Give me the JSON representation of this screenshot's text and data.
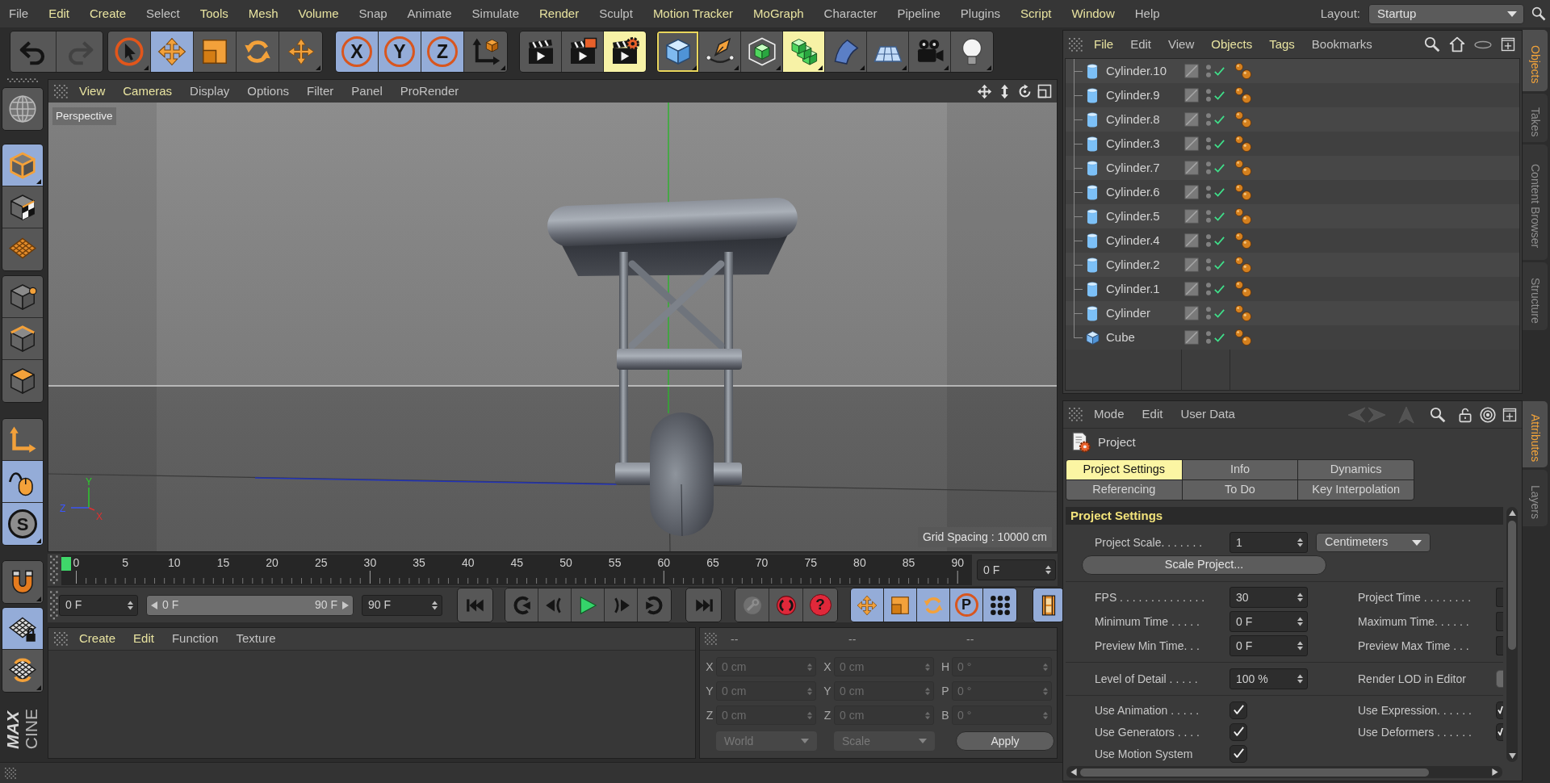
{
  "menu_bar": {
    "items": [
      {
        "label": "File",
        "highlighted": false
      },
      {
        "label": "Edit",
        "highlighted": true
      },
      {
        "label": "Create",
        "highlighted": true
      },
      {
        "label": "Select",
        "highlighted": false
      },
      {
        "label": "Tools",
        "highlighted": true
      },
      {
        "label": "Mesh",
        "highlighted": true
      },
      {
        "label": "Volume",
        "highlighted": true
      },
      {
        "label": "Snap",
        "highlighted": false
      },
      {
        "label": "Animate",
        "highlighted": false
      },
      {
        "label": "Simulate",
        "highlighted": false
      },
      {
        "label": "Render",
        "highlighted": true
      },
      {
        "label": "Sculpt",
        "highlighted": false
      },
      {
        "label": "Motion Tracker",
        "highlighted": true
      },
      {
        "label": "MoGraph",
        "highlighted": true
      },
      {
        "label": "Character",
        "highlighted": false
      },
      {
        "label": "Pipeline",
        "highlighted": false
      },
      {
        "label": "Plugins",
        "highlighted": false
      },
      {
        "label": "Script",
        "highlighted": true
      },
      {
        "label": "Window",
        "highlighted": true
      },
      {
        "label": "Help",
        "highlighted": false
      }
    ],
    "layout_label": "Layout:",
    "layout_value": "Startup"
  },
  "toolbar": {
    "groups": [
      {
        "tools": [
          {
            "disabled": false
          },
          {
            "disabled": true
          }
        ]
      },
      {
        "tools": [
          {
            "selected": false
          },
          {
            "selected": true
          },
          {
            "selected": false
          },
          {
            "selected": false
          },
          {
            "selected": false
          }
        ]
      },
      {
        "tools": [
          {
            "label": "X",
            "selected": true
          },
          {
            "label": "Y",
            "selected": true
          },
          {
            "label": "Z",
            "selected": true
          },
          {
            "selected": false
          }
        ]
      },
      {
        "tools": [
          {
            "highlighted": false
          },
          {
            "highlighted": false
          },
          {
            "highlighted": true
          }
        ]
      },
      {
        "tools": [
          {
            "highlighted": false,
            "focused": true
          },
          {
            "highlighted": false,
            "focused": false
          },
          {
            "highlighted": false,
            "focused": false
          },
          {
            "highlighted": true,
            "focused": false
          },
          {
            "highlighted": false,
            "focused": false
          },
          {
            "highlighted": false,
            "focused": false
          },
          {
            "highlighted": false,
            "focused": false
          },
          {
            "highlighted": false,
            "focused": false
          }
        ]
      }
    ]
  },
  "left_toolbar": {
    "tools": [
      {
        "selected": false
      },
      {
        "selected": true
      },
      {
        "selected": false
      },
      {
        "selected": false
      },
      {
        "selected": false
      },
      {
        "selected": false
      },
      {
        "selected": false
      },
      {
        "selected": false
      },
      {
        "selected": true
      },
      {
        "label": "S",
        "selected": true
      },
      {
        "selected": false
      },
      {
        "selected": true
      },
      {
        "selected": false
      }
    ],
    "logo": [
      "MAX",
      "CINE"
    ]
  },
  "viewport": {
    "menu": [
      {
        "label": "View",
        "highlighted": true
      },
      {
        "label": "Cameras",
        "highlighted": true
      },
      {
        "label": "Display",
        "highlighted": false
      },
      {
        "label": "Options",
        "highlighted": false
      },
      {
        "label": "Filter",
        "highlighted": false
      },
      {
        "label": "Panel",
        "highlighted": false
      },
      {
        "label": "ProRender",
        "highlighted": false
      }
    ],
    "camera": "Perspective",
    "axis_labels": {
      "y": "Y",
      "z": "Z",
      "x": "X"
    },
    "grid_spacing": "Grid Spacing : 10000 cm"
  },
  "timeline": {
    "ticks": [
      "0",
      "5",
      "10",
      "15",
      "20",
      "25",
      "30",
      "35",
      "40",
      "45",
      "50",
      "55",
      "60",
      "65",
      "70",
      "75",
      "80",
      "85",
      "90"
    ],
    "playhead": {
      "level": 0
    },
    "frame_field": "0 F"
  },
  "transport": {
    "start_field": "0 F",
    "range": {
      "start": "0 F",
      "end": "90 F"
    },
    "end_field": "90 F",
    "record_tools": [
      {
        "disabled": true
      },
      {
        "disabled": false
      },
      {
        "label": "?",
        "disabled": false
      }
    ],
    "key_tools": [
      {
        "selected": true
      },
      {
        "selected": true
      },
      {
        "selected": true
      },
      {
        "label": "P",
        "selected": true
      },
      {
        "selected": true
      }
    ],
    "timeline_button": {
      "selected": true
    }
  },
  "materials": {
    "menu": [
      {
        "label": "Create",
        "highlighted": true
      },
      {
        "label": "Edit",
        "highlighted": true
      },
      {
        "label": "Function",
        "highlighted": false
      },
      {
        "label": "Texture",
        "highlighted": false
      }
    ]
  },
  "coordinates": {
    "disabled": true,
    "headers": [
      "--",
      "--",
      "--"
    ],
    "rows": [
      {
        "cells": [
          {
            "axis": "X",
            "value": "0 cm"
          },
          {
            "axis": "X",
            "value": "0 cm"
          },
          {
            "axis": "H",
            "value": "0 °"
          }
        ]
      },
      {
        "cells": [
          {
            "axis": "Y",
            "value": "0 cm"
          },
          {
            "axis": "Y",
            "value": "0 cm"
          },
          {
            "axis": "P",
            "value": "0 °"
          }
        ]
      },
      {
        "cells": [
          {
            "axis": "Z",
            "value": "0 cm"
          },
          {
            "axis": "Z",
            "value": "0 cm"
          },
          {
            "axis": "B",
            "value": "0 °"
          }
        ]
      }
    ],
    "dropdowns": [
      "World",
      "Scale"
    ],
    "apply": "Apply"
  },
  "objects_panel": {
    "menu": [
      {
        "label": "File",
        "highlighted": true
      },
      {
        "label": "Edit",
        "highlighted": false
      },
      {
        "label": "View",
        "highlighted": false
      },
      {
        "label": "Objects",
        "highlighted": true
      },
      {
        "label": "Tags",
        "highlighted": true
      },
      {
        "label": "Bookmarks",
        "highlighted": false
      }
    ],
    "objects": [
      {
        "name": "Cylinder.10",
        "kind": "cylinder",
        "enabled": true
      },
      {
        "name": "Cylinder.9",
        "kind": "cylinder",
        "enabled": true
      },
      {
        "name": "Cylinder.8",
        "kind": "cylinder",
        "enabled": true
      },
      {
        "name": "Cylinder.3",
        "kind": "cylinder",
        "enabled": true
      },
      {
        "name": "Cylinder.7",
        "kind": "cylinder",
        "enabled": true
      },
      {
        "name": "Cylinder.6",
        "kind": "cylinder",
        "enabled": true
      },
      {
        "name": "Cylinder.5",
        "kind": "cylinder",
        "enabled": true
      },
      {
        "name": "Cylinder.4",
        "kind": "cylinder",
        "enabled": true
      },
      {
        "name": "Cylinder.2",
        "kind": "cylinder",
        "enabled": true
      },
      {
        "name": "Cylinder.1",
        "kind": "cylinder",
        "enabled": true
      },
      {
        "name": "Cylinder",
        "kind": "cylinder",
        "enabled": true
      },
      {
        "name": "Cube",
        "kind": "cube",
        "enabled": true
      }
    ]
  },
  "side_tabs": {
    "top": [
      {
        "label": "Objects",
        "selected": true
      },
      {
        "label": "Takes",
        "selected": false
      },
      {
        "label": "Content Browser",
        "selected": false
      },
      {
        "label": "Structure",
        "selected": false
      }
    ],
    "bottom": [
      {
        "label": "Attributes",
        "selected": true
      },
      {
        "label": "Layers",
        "selected": false
      }
    ]
  },
  "attributes": {
    "menu": [
      "Mode",
      "Edit",
      "User Data"
    ],
    "nav_disabled": true,
    "title": "Project",
    "tabs": [
      {
        "label": "Project Settings",
        "selected": true
      },
      {
        "label": "Info",
        "selected": false
      },
      {
        "label": "Dynamics",
        "selected": false
      },
      {
        "label": "Referencing",
        "selected": false
      },
      {
        "label": "To Do",
        "selected": false
      },
      {
        "label": "Key Interpolation",
        "selected": false
      }
    ],
    "section": "Project Settings",
    "scale": {
      "label": "Project Scale. . . . . . .",
      "value": "1",
      "unit": "Centimeters"
    },
    "scale_button": "Scale Project...",
    "time_rows": [
      {
        "label": "FPS . . . . . . . . . . . . . .",
        "value": "30",
        "right_label": "Project Time . . . . . . . ."
      },
      {
        "label": "Minimum Time . . . . .",
        "value": "0 F",
        "right_label": "Maximum Time. . . . . ."
      },
      {
        "label": "Preview Min Time. . .",
        "value": "0 F",
        "right_label": "Preview Max Time . . ."
      }
    ],
    "lod_row": {
      "label": "Level of Detail . . . . .",
      "value": "100 %",
      "right_label": "Render LOD in Editor",
      "right_checked": false
    },
    "flags": [
      {
        "label": "Use Animation . . . . .",
        "checked": true,
        "right_label": "Use Expression. . . . . .",
        "right_checked": true
      },
      {
        "label": "Use Generators . . . .",
        "checked": true,
        "right_label": "Use Deformers . . . . . .",
        "right_checked": true
      },
      {
        "label": "Use Motion System",
        "checked": true
      }
    ]
  }
}
